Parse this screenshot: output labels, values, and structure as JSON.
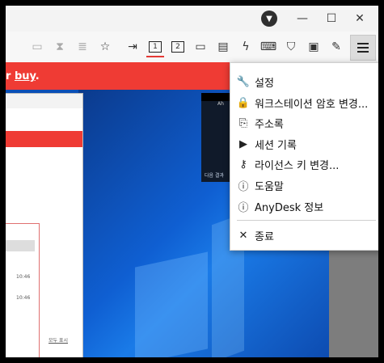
{
  "titlebar": {
    "download_icon": "download-icon",
    "minimize_glyph": "—",
    "maximize_glyph": "☐",
    "close_glyph": "✕"
  },
  "toolbar": {
    "monitor1_label": "1",
    "monitor2_label": "2"
  },
  "banner": {
    "text_prefix": "r ",
    "link": "buy",
    "suffix": "."
  },
  "menu": {
    "items": [
      {
        "label": "설정",
        "icon": "wrench-icon"
      },
      {
        "label": "워크스테이션 암호 변경...",
        "icon": "lock-icon"
      },
      {
        "label": "주소록",
        "icon": "address-book-icon"
      },
      {
        "label": "세션 기록",
        "icon": "session-record-icon"
      },
      {
        "label": "라이선스 키 변경...",
        "icon": "key-icon"
      },
      {
        "label": "도움말",
        "icon": "help-icon"
      },
      {
        "label": "AnyDesk 정보",
        "icon": "info-icon"
      },
      {
        "label": "종료",
        "icon": "close-icon"
      }
    ]
  },
  "remote": {
    "mini_times": [
      "10:46",
      "10:46"
    ],
    "mini_link": "모두 표시",
    "black_title": "Ah",
    "black_text": "다음 결과"
  },
  "colors": {
    "accent": "#ef3b34",
    "desktop": "#0f5fd2"
  }
}
